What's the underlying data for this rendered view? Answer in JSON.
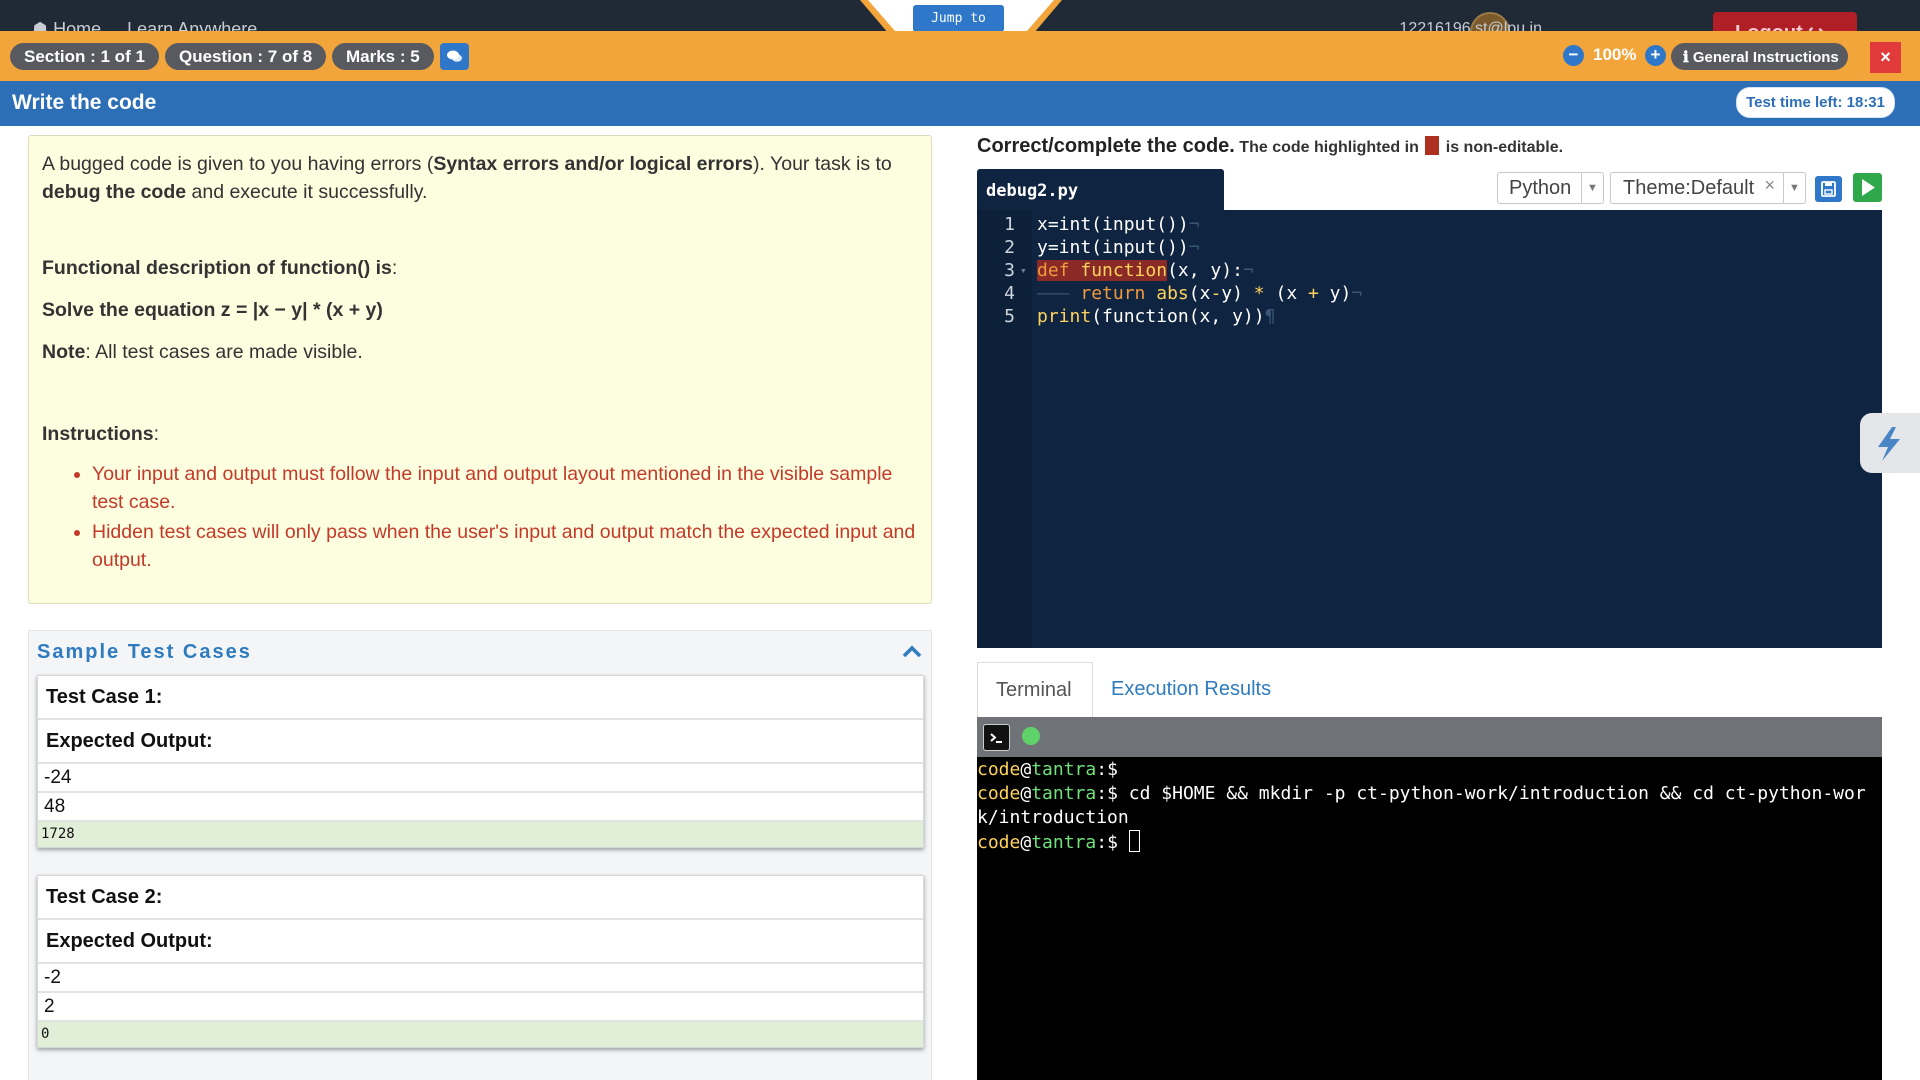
{
  "top_nav": {
    "home": "Home",
    "learn": "Learn Anywhere",
    "user": "12216196.st@lpu.in",
    "logout": "Logout"
  },
  "jump_to": "Jump to",
  "header": {
    "section": "Section : 1 of 1",
    "question": "Question : 7 of 8",
    "marks": "Marks : 5",
    "zoom": "100%",
    "general_instructions": "General Instructions",
    "close": "×"
  },
  "title_bar": {
    "title": "Write the code",
    "time_left": "Test time left: 18:31"
  },
  "problem": {
    "intro_1": "A bugged code is given to you having errors (",
    "intro_bold_1": "Syntax errors and/or logical errors",
    "intro_2": "). Your task is to ",
    "intro_bold_2": "debug the code",
    "intro_3": " and execute it successfully.",
    "func_label": "Functional description of function() is",
    "colon": ":",
    "equation": "Solve the equation z = |x − y| * (x + y)",
    "note_label": "Note",
    "note_text": ": All test cases are made visible.",
    "instructions_label": "Instructions",
    "instructions": [
      "Your input and output must follow the input and output layout mentioned in the visible sample test case.",
      "Hidden test cases will only pass when the user's input and output match the expected input and output."
    ]
  },
  "sample_cases": {
    "title": "Sample Test Cases",
    "expected_label": "Expected Output:",
    "cases": [
      {
        "title": "Test Case 1:",
        "inputs": [
          "-24",
          "48"
        ],
        "output": "1728"
      },
      {
        "title": "Test Case 2:",
        "inputs": [
          "-2",
          "2"
        ],
        "output": "0"
      }
    ]
  },
  "editor": {
    "hint_main": "Correct/complete the code.",
    "hint_pre": "The code highlighted in",
    "hint_post": "is non-editable.",
    "filename": "debug2.py",
    "language": "Python",
    "theme": "Theme:Default",
    "line_numbers": [
      "1",
      "2",
      "3",
      "4",
      "5"
    ],
    "lines": [
      "x=int(input())",
      "y=int(input())",
      "def function(x, y):",
      "    return abs(x-y) * (x + y)",
      "print(function(x, y))"
    ]
  },
  "terminal": {
    "tabs": [
      "Terminal",
      "Execution Results"
    ],
    "user": "code",
    "at": "@",
    "host": "tantra",
    "suffix": ":$",
    "command": " cd $HOME && mkdir -p ct-python-work/introduction && cd ct-python-work/introduction"
  },
  "colors": {
    "orange": "#f2a53b",
    "blue": "#2d6fb6",
    "editor_bg": "#0f2440",
    "locked": "#8a2a26"
  }
}
